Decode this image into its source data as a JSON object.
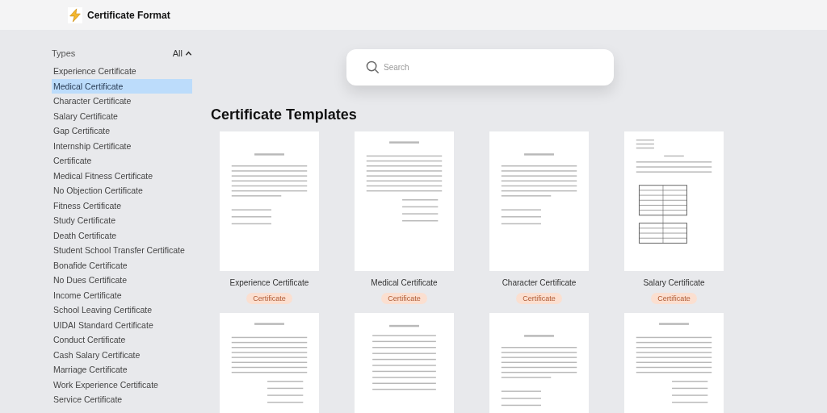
{
  "header": {
    "title": "Certificate Format"
  },
  "sidebar": {
    "heading": "Types",
    "filter": "All",
    "expanded": true,
    "items": [
      {
        "label": "Experience Certificate",
        "selected": false
      },
      {
        "label": "Medical Certificate",
        "selected": true
      },
      {
        "label": "Character Certificate",
        "selected": false
      },
      {
        "label": "Salary Certificate",
        "selected": false
      },
      {
        "label": "Gap Certificate",
        "selected": false
      },
      {
        "label": "Internship Certificate",
        "selected": false
      },
      {
        "label": "Certificate",
        "selected": false
      },
      {
        "label": "Medical Fitness Certificate",
        "selected": false
      },
      {
        "label": "No Objection Certificate",
        "selected": false
      },
      {
        "label": "Fitness Certificate",
        "selected": false
      },
      {
        "label": "Study Certificate",
        "selected": false
      },
      {
        "label": "Death Certificate",
        "selected": false
      },
      {
        "label": "Student School Transfer Certificate",
        "selected": false
      },
      {
        "label": "Bonafide Certificate",
        "selected": false
      },
      {
        "label": "No Dues Certificate",
        "selected": false
      },
      {
        "label": "Income Certificate",
        "selected": false
      },
      {
        "label": "School Leaving Certificate",
        "selected": false
      },
      {
        "label": "UIDAI Standard Certificate",
        "selected": false
      },
      {
        "label": "Conduct Certificate",
        "selected": false
      },
      {
        "label": "Cash Salary Certificate",
        "selected": false
      },
      {
        "label": "Marriage Certificate",
        "selected": false
      },
      {
        "label": "Work Experience Certificate",
        "selected": false
      },
      {
        "label": "Service Certificate",
        "selected": false
      }
    ]
  },
  "search": {
    "placeholder": "Search"
  },
  "section_title": "Certificate Templates",
  "templates": [
    {
      "name": "Experience Certificate",
      "tag": "Certificate",
      "kind": "letter"
    },
    {
      "name": "Medical Certificate",
      "tag": "Certificate",
      "kind": "form"
    },
    {
      "name": "Character Certificate",
      "tag": "Certificate",
      "kind": "letter"
    },
    {
      "name": "Salary Certificate",
      "tag": "Certificate",
      "kind": "table"
    },
    {
      "kind": "form"
    },
    {
      "kind": "list"
    },
    {
      "kind": "letter"
    },
    {
      "kind": "form"
    }
  ]
}
